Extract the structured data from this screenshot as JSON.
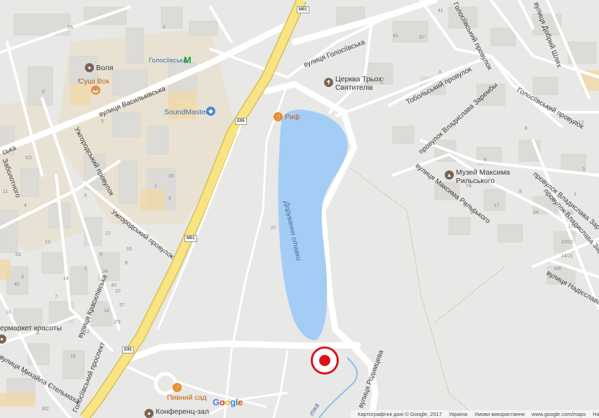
{
  "streets": {
    "holosiivska": "вулиця Голосіївська",
    "vasylkivska": "вулиця Васильківська",
    "vasylkivska_left": "ська",
    "uzhgorodskyi_1": "Ужгородський провулок",
    "uzhgorodskyi_2": "Ужгородський провулок",
    "zabolotnoho": "Заболотного",
    "krasylivska": "вулиця Красилівська",
    "holosiivskyi_prospekt": "Голосіївський проспект",
    "mykhaila_stelmakha": "вулиця Михайла Стельмаха",
    "maksyma_rylskoho": "вулиця Максима Рильського",
    "holosiivskyi_provulok_top": "Голосіївський провулок",
    "holosiivskyi_provulok_right": "Голосіївський провулок",
    "tobolskyi": "Тобольський провулок",
    "vladyslava_zarembi_1": "провулок Владислава Зарембы",
    "vladyslava_zarembi_2": "провулок Владислава Заремби",
    "vladyslava_zarembi_3": "провулок Владислава Заремби",
    "dobryi_shliakh": "вулиця Добрий Шлях",
    "nadiislavi": "вулиця Надієслава",
    "rodymtseva": "вулиця Родимцева"
  },
  "water": {
    "lake_label": "Дорування ставки",
    "stream_label": "тка"
  },
  "pois": {
    "metro_station": "Голосіївська",
    "metro_icon_glyph": "M",
    "volia": "Воля",
    "sushi_vok": "Суші Вок",
    "soundmaster": "SoundMaster",
    "tserkva_line1": "Церква Трьох",
    "tserkva_line2": "Святителів",
    "rif": "Риф",
    "muzei_line1": "Музей Максима",
    "muzei_line2": "Рильського",
    "supermarket": "ермаркет красоты",
    "pyvnyi_sad": "Пивний сад",
    "konferents_zal": "Конференц-зал"
  },
  "shields": {
    "m01_top": "M01",
    "e95_top": "E95",
    "m01_mid": "M01",
    "e95_bottom": "E95"
  },
  "house_numbers": [
    "2А",
    "41",
    "67",
    "2",
    "6",
    "5/2",
    "1",
    "5",
    "11",
    "4",
    "3",
    "27",
    "5",
    "13",
    "9",
    "17",
    "8",
    "1",
    "7",
    "12",
    "19",
    "5",
    "3",
    "20/12",
    "41",
    "7А",
    "3",
    "9А",
    "17",
    "24",
    "51/1",
    "17/4",
    "10/32",
    "14/21",
    "4/8",
    "8",
    "6",
    "8",
    "3",
    "1",
    "16",
    "8",
    "10",
    "37",
    "2/9",
    "6",
    "17",
    "5",
    "8/2",
    "11",
    "40",
    "14",
    "34",
    "40",
    "14",
    "53",
    "33",
    "4",
    "5"
  ],
  "marker": {
    "label": "selected-location",
    "color": "#d8141c"
  },
  "branding": {
    "google_letters": [
      "G",
      "o",
      "o",
      "g",
      "l",
      "e"
    ],
    "google_colors": [
      "#4285f4",
      "#ea4335",
      "#fbbc05",
      "#4285f4",
      "#34a853",
      "#ea4335"
    ]
  },
  "footer": {
    "attribution": "Картографічні дані © Google, 2017",
    "country": "Україна",
    "terms": "Умови використання",
    "url": "www.google.com/maps",
    "report": "Надіслати"
  },
  "colors": {
    "land": "#e8e8e6",
    "road": "#ffffff",
    "highway": "#f6e07a",
    "water": "#a4cdf6",
    "building": "#dddcd9",
    "block": "#dad9d5"
  }
}
